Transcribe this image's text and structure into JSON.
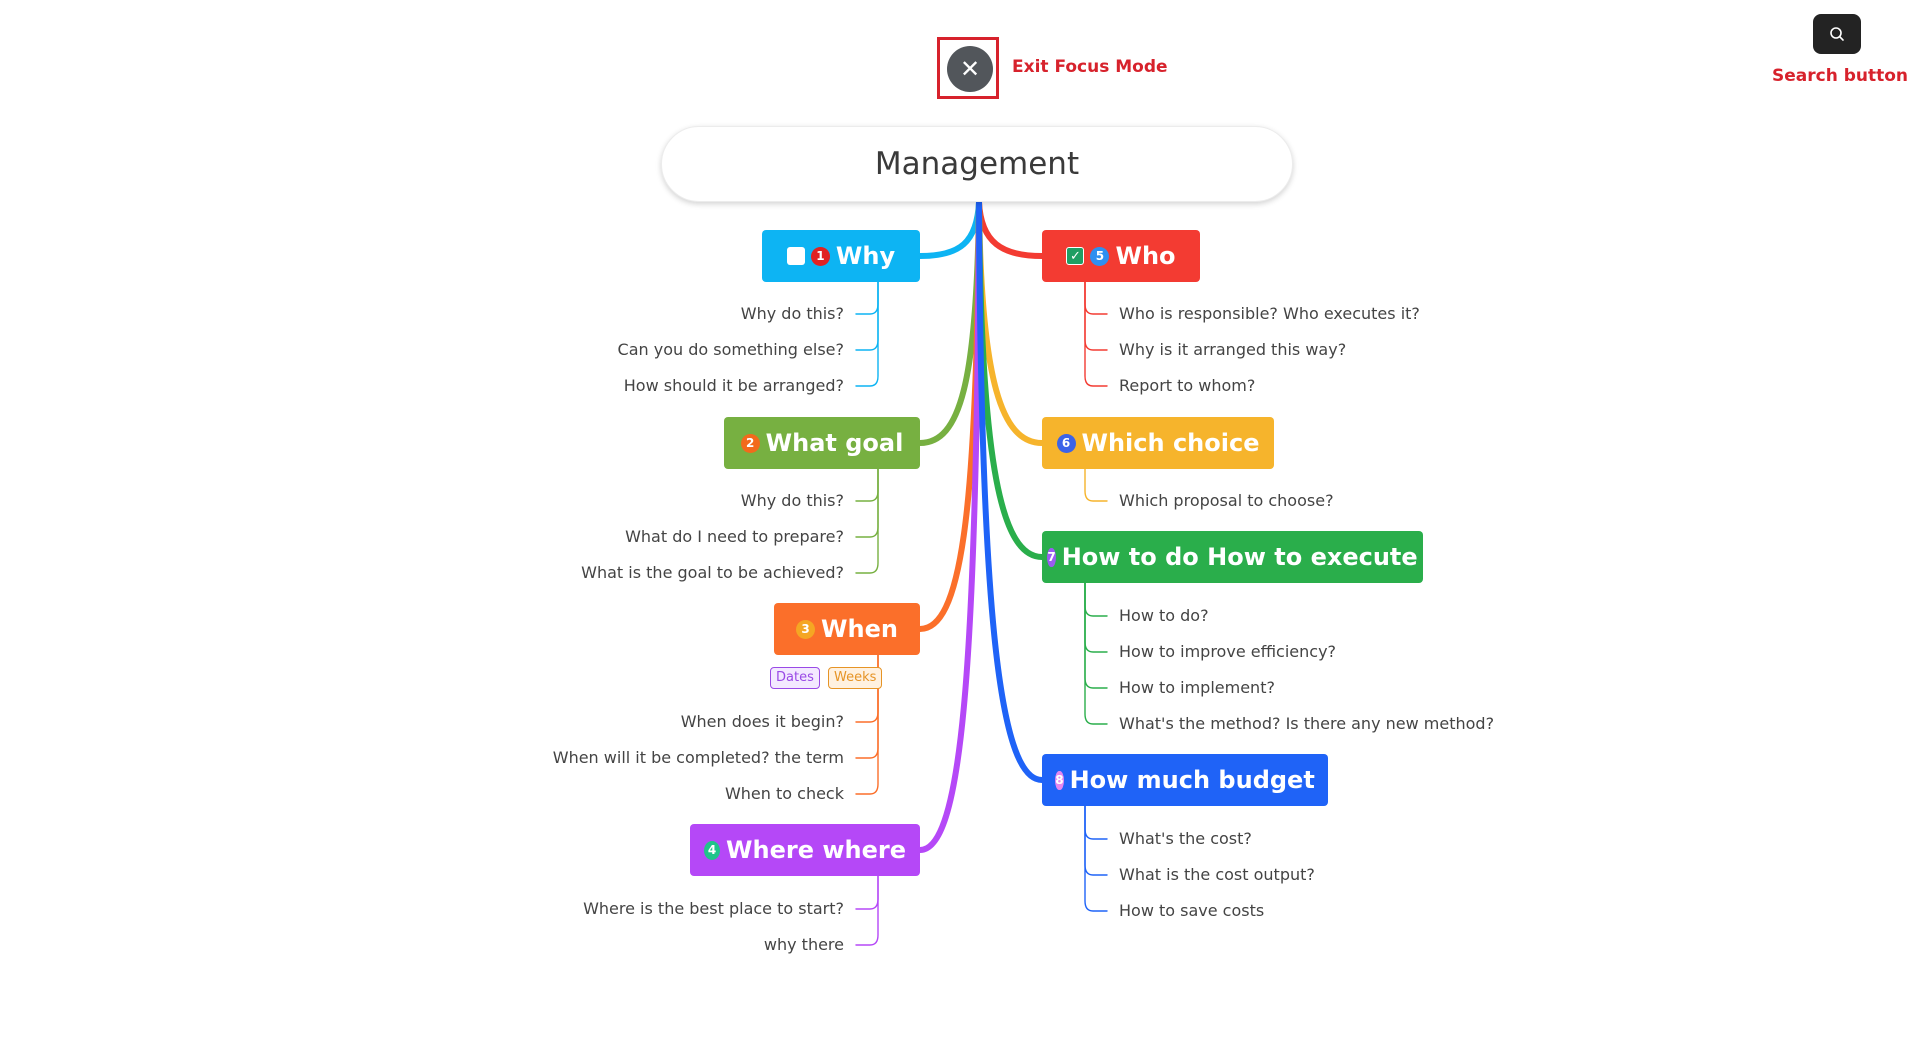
{
  "controls": {
    "exit_focus_icon": "close-icon",
    "exit_focus_glyph": "✕",
    "exit_focus_annotation": "Exit Focus Mode",
    "search_icon": "search-icon",
    "search_annotation": "Search button",
    "annotation_color": "#d7222c"
  },
  "root": {
    "title": "Management"
  },
  "branches": [
    {
      "id": "why",
      "side": "left",
      "label": "Why",
      "marker": "1",
      "marker_color": "#e02222",
      "checkbox": "unchecked",
      "color": "#0db4f3",
      "children": [
        "Why do this?",
        "Can you do something else?",
        "How should it be arranged?"
      ]
    },
    {
      "id": "what-goal",
      "side": "left",
      "label": "What goal",
      "marker": "2",
      "marker_color": "#f26a1b",
      "color": "#77b041",
      "children": [
        "Why do this?",
        "What do I need to prepare?",
        "What is the goal to be achieved?"
      ]
    },
    {
      "id": "when",
      "side": "left",
      "label": "When",
      "marker": "3",
      "marker_color": "#f5a623",
      "color": "#fb6f2a",
      "tags": [
        {
          "label": "Dates",
          "color": "#9a4ae6",
          "bg": "#f3e9ff"
        },
        {
          "label": "Weeks",
          "color": "#e69426",
          "bg": "#fff1e0"
        }
      ],
      "children": [
        "When does it begin?",
        "When will it be completed? the term",
        "When to check"
      ]
    },
    {
      "id": "where",
      "side": "left",
      "label": "Where where",
      "marker": "4",
      "marker_color": "#20c48a",
      "color": "#b548f7",
      "children": [
        "Where is the best place to start?",
        "why there"
      ]
    },
    {
      "id": "who",
      "side": "right",
      "label": "Who",
      "marker": "5",
      "marker_color": "#2f8ff0",
      "checkbox": "checked",
      "color": "#f33b32",
      "children": [
        "Who is responsible? Who executes it?",
        "Why is it arranged this way?",
        "Report to whom?"
      ]
    },
    {
      "id": "which-choice",
      "side": "right",
      "label": "Which choice",
      "marker": "6",
      "marker_color": "#3b63e8",
      "color": "#f6b42c",
      "children": [
        "Which proposal to choose?"
      ]
    },
    {
      "id": "how-to-do",
      "side": "right",
      "label": "How to do How to execute",
      "marker": "7",
      "marker_color": "#9a5cf0",
      "color": "#2aae4b",
      "children": [
        "How to do?",
        "How to improve efficiency?",
        "How to implement?",
        "What's the method? Is there any new method?"
      ]
    },
    {
      "id": "how-much-budget",
      "side": "right",
      "label": "How much budget",
      "marker": "8",
      "marker_color": "#e487f0",
      "color": "#1f63f7",
      "children": [
        "What's the cost?",
        "What is the cost output?",
        "How to save costs"
      ]
    }
  ]
}
